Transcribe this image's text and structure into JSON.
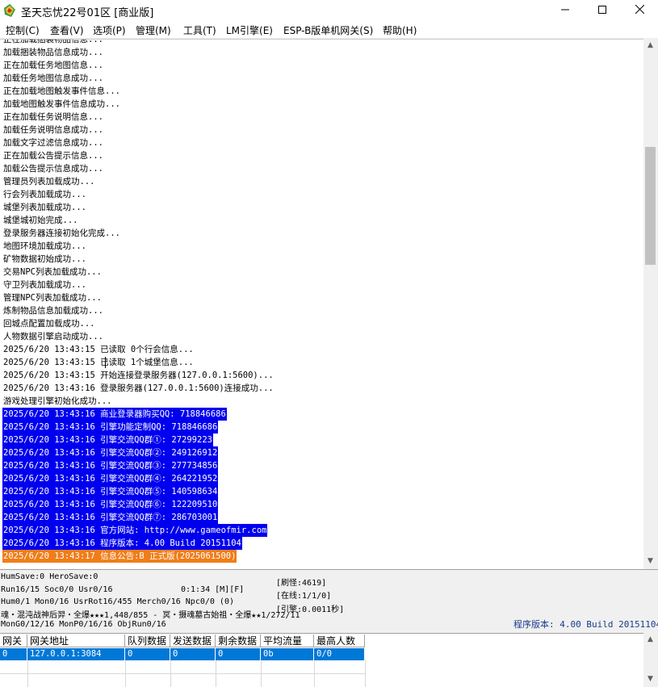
{
  "window": {
    "title": "圣天忘忧22号01区 [商业版]",
    "minimize": "—",
    "maximize": "☐",
    "close": "✕",
    "icon": "game-app-icon"
  },
  "menu": [
    "控制(C)",
    "查看(V)",
    "选项(P)",
    "管理(M)",
    "工具(T)",
    "LM引擎(E)",
    "ESP-B版单机网关(S)",
    "帮助(H)"
  ],
  "log": {
    "partial_top": "正在加载捆装物品信息...",
    "lines": [
      {
        "text": "加载捆装物品信息成功...",
        "style": "normal"
      },
      {
        "text": "正在加载任务地图信息...",
        "style": "normal"
      },
      {
        "text": "加载任务地图信息成功...",
        "style": "normal"
      },
      {
        "text": "正在加载地图触发事件信息...",
        "style": "normal"
      },
      {
        "text": "加载地图触发事件信息成功...",
        "style": "normal"
      },
      {
        "text": "正在加载任务说明信息...",
        "style": "normal"
      },
      {
        "text": "加载任务说明信息成功...",
        "style": "normal"
      },
      {
        "text": "加载文字过滤信息成功...",
        "style": "normal"
      },
      {
        "text": "正在加载公告提示信息...",
        "style": "normal"
      },
      {
        "text": "加载公告提示信息成功...",
        "style": "normal"
      },
      {
        "text": "管理员列表加载成功...",
        "style": "normal"
      },
      {
        "text": "行会列表加载成功...",
        "style": "normal"
      },
      {
        "text": "城堡列表加载成功...",
        "style": "normal"
      },
      {
        "text": "城堡城初始完成...",
        "style": "normal"
      },
      {
        "text": "登录服务器连接初始化完成...",
        "style": "normal"
      },
      {
        "text": "地图环境加载成功...",
        "style": "normal"
      },
      {
        "text": "矿物数据初始成功...",
        "style": "normal"
      },
      {
        "text": "交易NPC列表加载成功...",
        "style": "normal"
      },
      {
        "text": "守卫列表加载成功...",
        "style": "normal"
      },
      {
        "text": "管理NPC列表加载成功...",
        "style": "normal"
      },
      {
        "text": "炼制物品信息加载成功...",
        "style": "normal"
      },
      {
        "text": "回城点配置加载成功...",
        "style": "normal"
      },
      {
        "text": "人物数据引擎启动成功...",
        "style": "normal"
      },
      {
        "text": "2025/6/20 13:43:15 已读取 0个行会信息...",
        "style": "normal"
      },
      {
        "text": "2025/6/20 13:43:15 已读取 1个城堡信息...",
        "style": "normal"
      },
      {
        "text": "2025/6/20 13:43:15 开始连接登录服务器(127.0.0.1:5600)...",
        "style": "normal"
      },
      {
        "text": "2025/6/20 13:43:16 登录服务器(127.0.0.1:5600)连接成功...",
        "style": "normal"
      },
      {
        "text": "游戏处理引擎初始化成功...",
        "style": "normal"
      },
      {
        "text": "2025/6/20 13:43:16 商业登录器购买QQ: 718846686",
        "style": "blue"
      },
      {
        "text": "2025/6/20 13:43:16 引擎功能定制QQ: 718846686",
        "style": "blue"
      },
      {
        "text": "2025/6/20 13:43:16 引擎交流QQ群①: 27299223",
        "style": "blue"
      },
      {
        "text": "2025/6/20 13:43:16 引擎交流QQ群②: 249126912",
        "style": "blue"
      },
      {
        "text": "2025/6/20 13:43:16 引擎交流QQ群③: 277734856",
        "style": "blue"
      },
      {
        "text": "2025/6/20 13:43:16 引擎交流QQ群④: 264221952",
        "style": "blue"
      },
      {
        "text": "2025/6/20 13:43:16 引擎交流QQ群⑤: 140598634",
        "style": "blue"
      },
      {
        "text": "2025/6/20 13:43:16 引擎交流QQ群⑥: 122209510",
        "style": "blue"
      },
      {
        "text": "2025/6/20 13:43:16 引擎交流QQ群⑦: 286703001",
        "style": "blue"
      },
      {
        "text": "2025/6/20 13:43:16 官方网站: http://www.gameofmir.com",
        "style": "blue"
      },
      {
        "text": "2025/6/20 13:43:16 程序版本: 4.00 Build 20151104",
        "style": "blue"
      },
      {
        "text": "2025/6/20 13:43:17 信息公告:B 正式版(2025061500)",
        "style": "orange"
      }
    ]
  },
  "status": {
    "save": "HumSave:0 HeroSave:0",
    "run": "Run16/15 Soc0/0 Usr0/16",
    "timer": "0:1:34 [M][F]",
    "refresh": "[刷怪:4619]",
    "online": "[在线:1/1/0]",
    "engine": "[引擎:0.0011秒]",
    "counters": "Hum0/1 Mon0/16 UsrRot16/455 Merch0/16 Npc0/0 (0)",
    "scroll_msg": "魂・混沌战神后羿・全爆★★★1,448/855 - 冥・摄魂墓古始祖・全爆★★1/272/11",
    "groups": "MonG0/12/16 MonP0/16/16 ObjRun0/16",
    "version": "程序版本: 4.00 Build 20151104"
  },
  "gate_table": {
    "headers": [
      "网关",
      "网关地址",
      "队列数据",
      "发送数据",
      "剩余数据",
      "平均流量",
      "最高人数"
    ],
    "rows": [
      [
        "0",
        "127.0.0.1:3084",
        "0",
        "0",
        "0",
        "0b",
        "0/0"
      ]
    ]
  }
}
